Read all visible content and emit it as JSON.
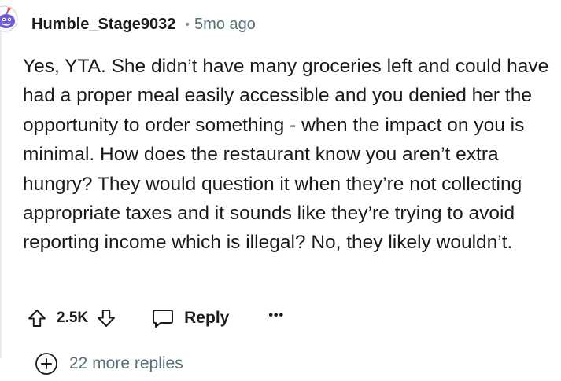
{
  "comment": {
    "username": "Humble_Stage9032",
    "separator": "•",
    "timestamp": "5mo ago",
    "body": [
      "Yes, YTA. She didn’t have many groceries left and could have had a proper meal easily accessible and you denied her the opportunity to order something - when the impact on you is minimal. How does the restaurant know you aren’t extra hungry? They would question it when they’re not collecting appropriate taxes and it sounds like they’re trying to avoid reporting income which is illegal? No, they likely wouldn’t."
    ],
    "score": "2.5K",
    "reply_label": "Reply",
    "more_label": "•••",
    "more_replies": "22 more replies"
  },
  "icons": {
    "avatar": "snoo-avatar-icon",
    "upvote": "upvote-arrow-icon",
    "downvote": "downvote-arrow-icon",
    "reply": "speech-bubble-icon",
    "more": "ellipsis-icon",
    "expand": "plus-circle-icon"
  },
  "colors": {
    "avatar_primary": "#6f5ad8",
    "avatar_accent": "#ff4500",
    "meta_text": "#576f76"
  }
}
